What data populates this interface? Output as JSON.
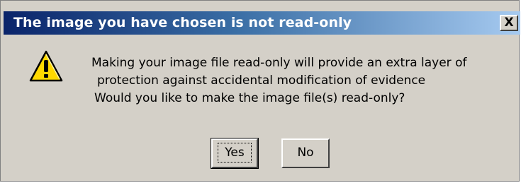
{
  "dialog": {
    "title": "The image you have chosen is not read-only",
    "close_label": "X",
    "icon": "warning-icon",
    "message_lines": [
      "Making your image file read-only will provide an extra layer of",
      "protection against accidental modification of evidence",
      "Would you like to make the image file(s) read-only?"
    ],
    "buttons": {
      "yes_label": "Yes",
      "no_label": "No"
    }
  },
  "colors": {
    "title_bar_start": "#0a246a",
    "title_bar_end": "#a6caf0",
    "dialog_face": "#d4d0c8",
    "warning_yellow": "#ffd800"
  }
}
